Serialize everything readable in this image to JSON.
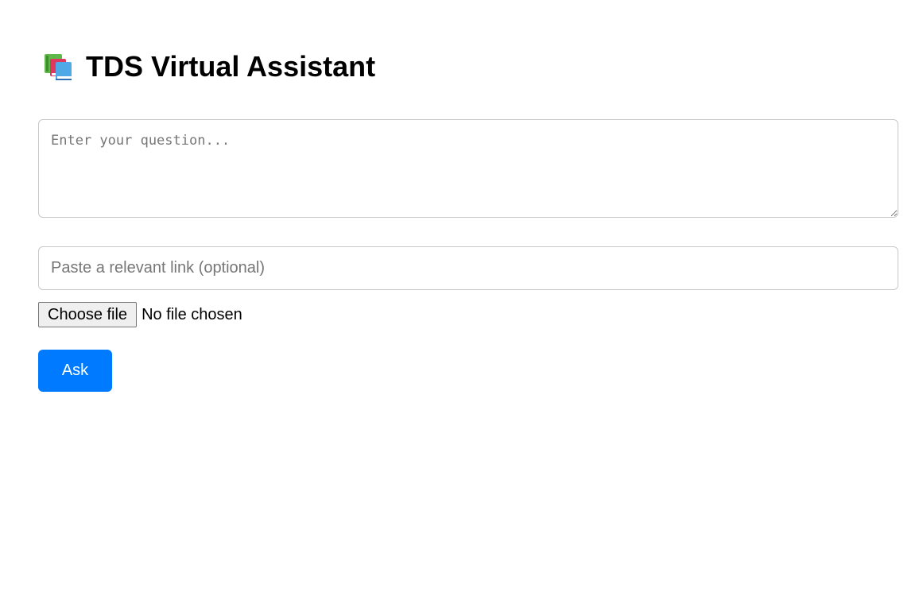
{
  "header": {
    "icon": "books-icon",
    "title": "TDS Virtual Assistant"
  },
  "form": {
    "question": {
      "value": "",
      "placeholder": "Enter your question..."
    },
    "link": {
      "value": "",
      "placeholder": "Paste a relevant link (optional)"
    },
    "file": {
      "button_label": "Choose file",
      "status": "No file chosen"
    },
    "submit_label": "Ask"
  },
  "colors": {
    "accent": "#007bff",
    "border": "#c8c8c8",
    "placeholder": "#767676"
  }
}
